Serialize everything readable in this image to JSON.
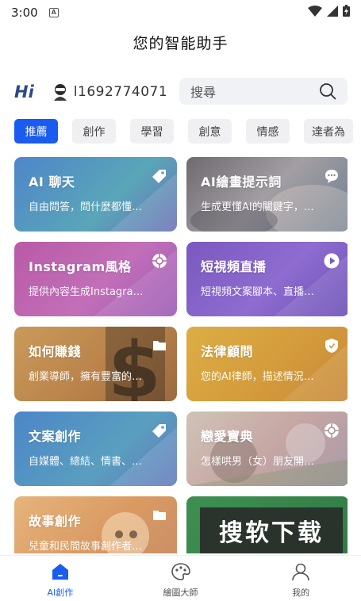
{
  "status_bar": {
    "time": "3:00"
  },
  "app_title": "您的智能助手",
  "user": {
    "greeting": "Hi",
    "username": "l1692774071"
  },
  "search": {
    "placeholder": "搜尋"
  },
  "tabs": [
    {
      "label": "推薦",
      "active": true
    },
    {
      "label": "創作",
      "active": false
    },
    {
      "label": "學習",
      "active": false
    },
    {
      "label": "創意",
      "active": false
    },
    {
      "label": "情感",
      "active": false
    },
    {
      "label": "達者為",
      "active": false
    }
  ],
  "cards": [
    {
      "title": "AI 聊天",
      "desc": "自由問答，問什麼都懂…",
      "icon": "tag-icon",
      "color": "#4a7fc1"
    },
    {
      "title": "AI繪畫提示詞",
      "desc": "生成更懂AI的關鍵字，…",
      "icon": "chat-bubble-icon",
      "color": "#8a7e86"
    },
    {
      "title": "Instagram風格",
      "desc": "提供內容生成Instagra…",
      "icon": "aperture-icon",
      "color": "#b55aa2"
    },
    {
      "title": "短視頻直播",
      "desc": "短視頻文案腳本、直播…",
      "icon": "play-icon",
      "color": "#7b5cc0"
    },
    {
      "title": "如何賺錢",
      "desc": "創業導師，擁有豐富的…",
      "icon": "folder-icon",
      "color": "#c58d4b"
    },
    {
      "title": "法律顧問",
      "desc": "您的AI律師，描述情況…",
      "icon": "shield-icon",
      "color": "#d9a83f"
    },
    {
      "title": "文案創作",
      "desc": "自媒體、總結、情書、…",
      "icon": "tag-icon",
      "color": "#4a7fc1"
    },
    {
      "title": "戀愛寶典",
      "desc": "怎樣哄男（女）朋友開…",
      "icon": "aperture-icon",
      "color": "#c9a6a0"
    },
    {
      "title": "故事創作",
      "desc": "兒童和民間故事創作者…",
      "icon": "folder-icon",
      "color": "#d9a265"
    },
    {
      "title": "",
      "desc": "",
      "icon": "",
      "color": "#3d8a4f"
    }
  ],
  "watermark": "搜软下载",
  "bottom_nav": [
    {
      "label": "AI創作",
      "active": true,
      "icon": "home-icon"
    },
    {
      "label": "繪圖大師",
      "active": false,
      "icon": "palette-icon"
    },
    {
      "label": "我的",
      "active": false,
      "icon": "user-icon"
    }
  ]
}
